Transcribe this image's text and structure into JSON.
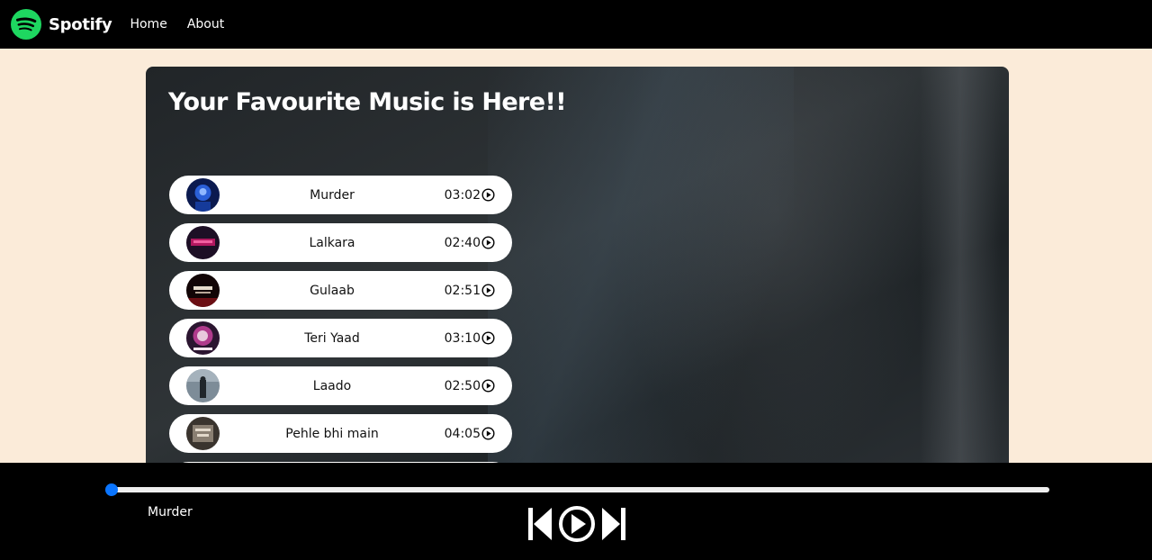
{
  "navbar": {
    "brand": "Spotify",
    "links": [
      "Home",
      "About"
    ],
    "brand_color": "#1ed760"
  },
  "main": {
    "heading": "Your Favourite Music is Here!!",
    "songs": [
      {
        "name": "Murder",
        "time": "03:02",
        "cover_color": "#1b3fa0"
      },
      {
        "name": "Lalkara",
        "time": "02:40",
        "cover_color": "#3a1640"
      },
      {
        "name": "Gulaab",
        "time": "02:51",
        "cover_color": "#3b0b0f"
      },
      {
        "name": "Teri Yaad",
        "time": "03:10",
        "cover_color": "#7a2a5e"
      },
      {
        "name": "Laado",
        "time": "02:50",
        "cover_color": "#5a6f80"
      },
      {
        "name": "Pehle bhi main",
        "time": "04:05",
        "cover_color": "#5a5048"
      }
    ]
  },
  "player": {
    "now_playing": "Murder",
    "progress": 0,
    "accent": "#0a75ff",
    "controls": [
      "previous-icon",
      "play-icon",
      "next-icon"
    ]
  }
}
